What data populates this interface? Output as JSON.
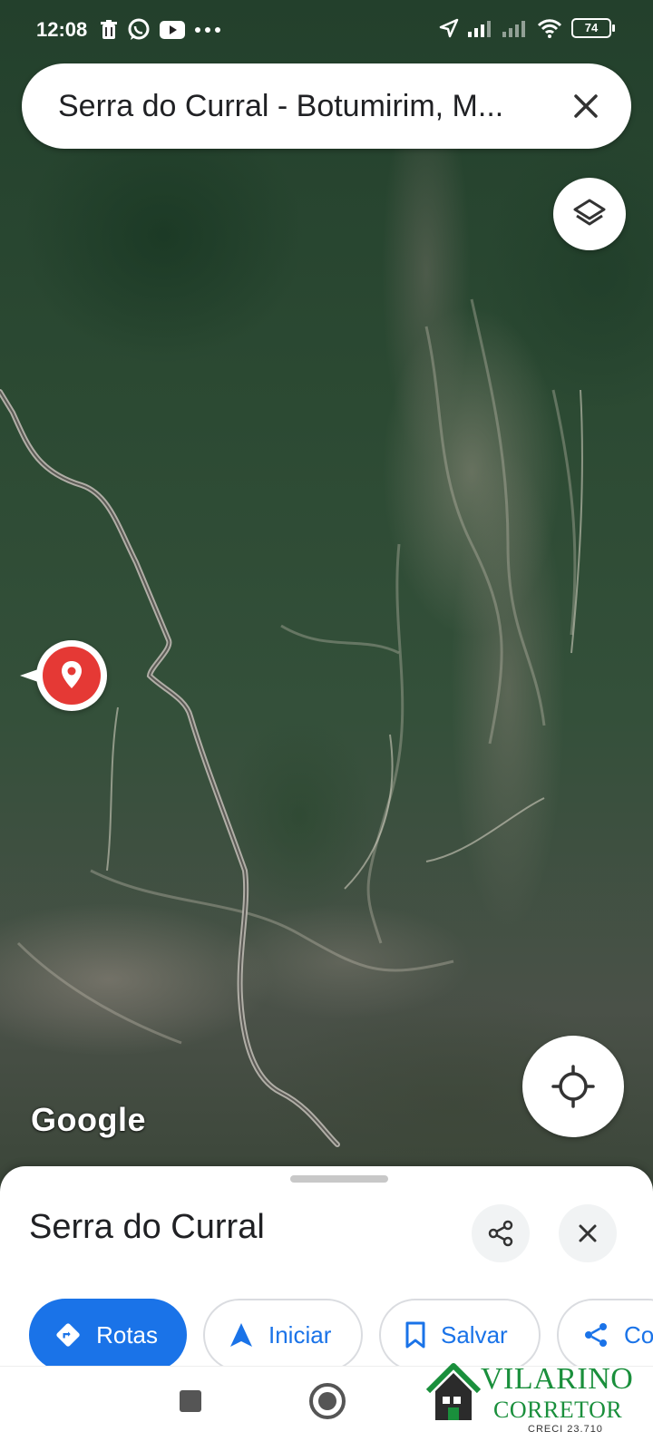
{
  "status_bar": {
    "time": "12:08",
    "battery": "74"
  },
  "search": {
    "query": "Serra do Curral - Botumirim, M..."
  },
  "map": {
    "attribution": "Google"
  },
  "place": {
    "name": "Serra do Curral"
  },
  "actions": {
    "rotas": "Rotas",
    "iniciar": "Iniciar",
    "salvar": "Salvar",
    "partial": "Co"
  },
  "watermark": {
    "brand": "VILARINO",
    "title": "CORRETOR",
    "license": "CRECI 23.710"
  },
  "colors": {
    "accent": "#1a73e8",
    "marker": "#e53935",
    "watermark": "#1a8f3c"
  },
  "icons": {
    "status_left": [
      "trash-icon",
      "whatsapp-icon",
      "youtube-icon",
      "more-dots-icon"
    ],
    "status_right": [
      "location-arrow-icon",
      "signal-icon",
      "signal-icon",
      "wifi-icon",
      "battery-icon"
    ]
  }
}
